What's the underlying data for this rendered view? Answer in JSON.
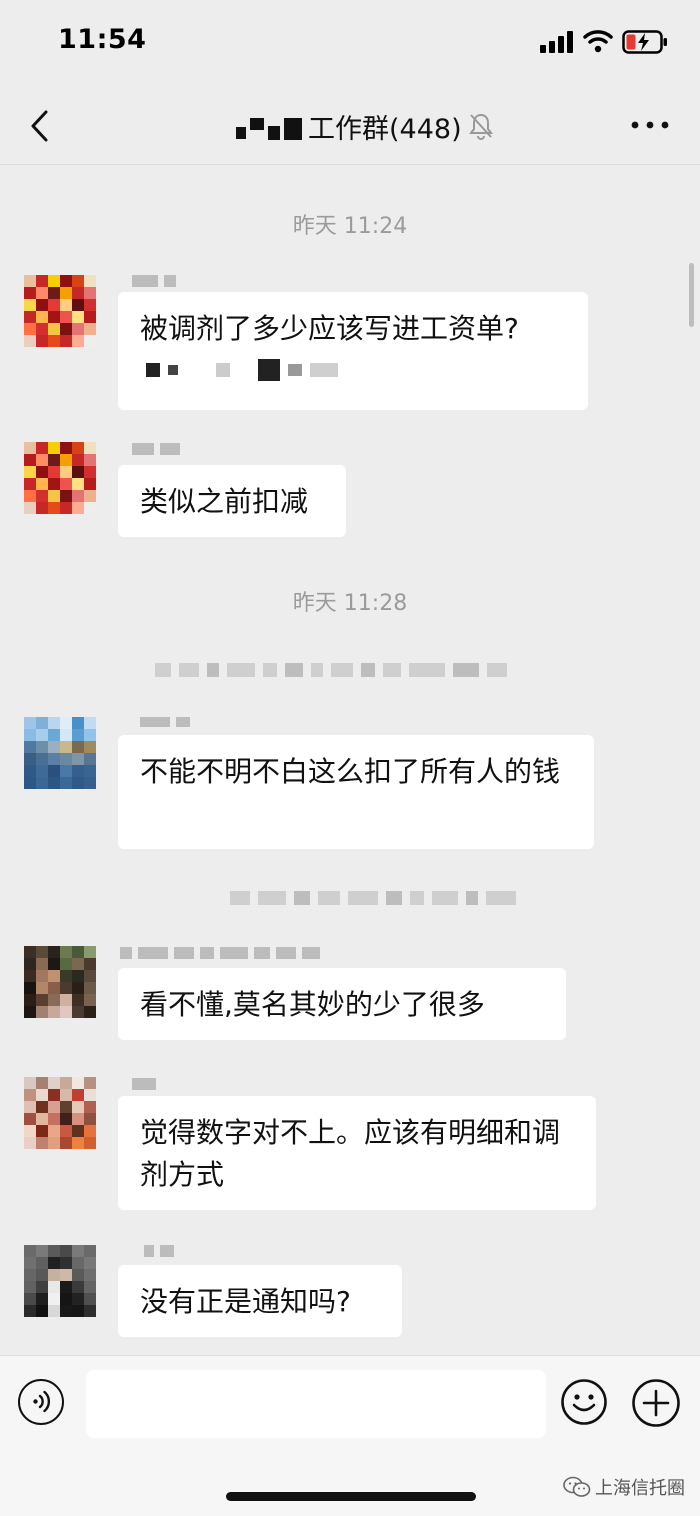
{
  "status_bar": {
    "time": "11:54"
  },
  "header": {
    "title": "工作群(448)"
  },
  "chat": {
    "timestamps": [
      "昨天 11:24",
      "昨天 11:28"
    ],
    "messages": [
      {
        "text": "被调剂了多少应该写进工资单?"
      },
      {
        "text": "类似之前扣减"
      },
      {
        "text": "不能不明不白这么扣了所有人的钱"
      },
      {
        "text": "看不懂,莫名其妙的少了很多"
      },
      {
        "text": "觉得数字对不上。应该有明细和调剂方式"
      },
      {
        "text": "没有正是通知吗?"
      }
    ]
  },
  "watermark": {
    "text": "上海信托圈"
  },
  "icons": [
    "back-icon",
    "mute-icon",
    "more-icon",
    "voice-icon",
    "emoji-icon",
    "plus-icon",
    "signal-icon",
    "wifi-icon",
    "battery-icon",
    "wechat-logo-icon"
  ],
  "colors": {
    "background": "#ededed",
    "bubble": "#ffffff",
    "timestamp": "#9b9b9b",
    "battery_low": "#e53935"
  }
}
